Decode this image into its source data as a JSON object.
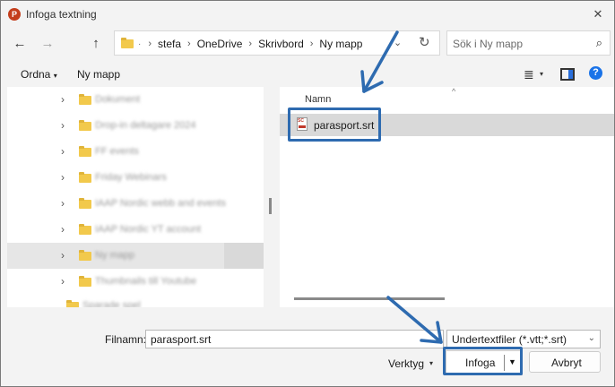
{
  "window": {
    "title": "Infoga textning",
    "app_icon_letter": "P",
    "close_glyph": "✕"
  },
  "nav": {
    "back_glyph": "←",
    "forward_glyph": "→",
    "up_glyph": "↑",
    "refresh_glyph": "↻",
    "dropdown_glyph": "⌄",
    "overflow_glyph": "·",
    "separator": "›",
    "breadcrumbs": [
      "stefa",
      "OneDrive",
      "Skrivbord",
      "Ny mapp"
    ]
  },
  "search": {
    "placeholder": "Sök i Ny mapp",
    "icon_glyph": "⌕"
  },
  "commands": {
    "organize": "Ordna",
    "organize_caret": "▾",
    "new_folder": "Ny mapp",
    "view_glyph": "≣",
    "view_caret": "▾",
    "help_glyph": "?"
  },
  "tree": {
    "chevron": "›",
    "items": [
      {
        "label": "Dokument"
      },
      {
        "label": "Drop-in deltagare 2024"
      },
      {
        "label": "FF events"
      },
      {
        "label": "Friday Webinars"
      },
      {
        "label": "IAAP Nordic webb and events"
      },
      {
        "label": "IAAP Nordic YT account"
      },
      {
        "label": "Ny mapp"
      },
      {
        "label": "Thumbnails till Youtube"
      }
    ],
    "partial_item": "Sparade spel"
  },
  "files": {
    "column_name": "Namn",
    "sort_glyph": "^",
    "items": [
      {
        "name": "parasport.srt",
        "icon": "srt-file-icon"
      }
    ]
  },
  "footer": {
    "filename_label": "Filnamn:",
    "filename_value": "parasport.srt",
    "filter_value": "Undertextfiler (*.vtt;*.srt)",
    "filter_caret": "⌄",
    "tools_label": "Verktyg",
    "tools_caret": "▾",
    "insert_label": "Infoga",
    "insert_caret": "▼",
    "cancel_label": "Avbryt"
  },
  "colors": {
    "annotation": "#2e6bb0",
    "folder": "#f2c94c",
    "selection": "#e6e6e6",
    "accent": "#1a73e8"
  }
}
